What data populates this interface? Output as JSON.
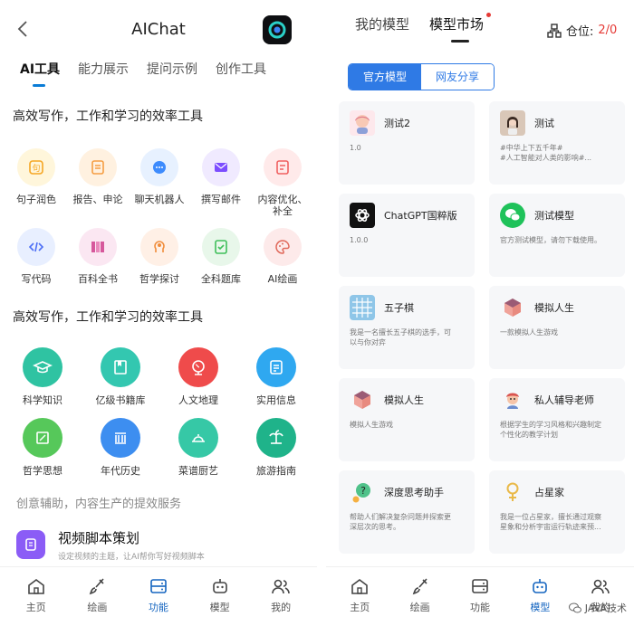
{
  "left": {
    "title": "AIChat",
    "tabs": [
      {
        "label": "AI工具",
        "active": true
      },
      {
        "label": "能力展示",
        "active": false
      },
      {
        "label": "提问示例",
        "active": false
      },
      {
        "label": "创作工具",
        "active": false
      }
    ],
    "section1_title": "高效写作，工作和学习的效率工具",
    "tools": [
      {
        "label": "句子润色",
        "icon": "quote-icon",
        "bg": "#fff6db",
        "fg": "#f5a623"
      },
      {
        "label": "报告、申论",
        "icon": "document-icon",
        "bg": "#fff1e0",
        "fg": "#f59e42"
      },
      {
        "label": "聊天机器人",
        "icon": "chat-bubble-icon",
        "bg": "#e7f1ff",
        "fg": "#3d8bfd"
      },
      {
        "label": "撰写邮件",
        "icon": "mail-icon",
        "bg": "#f0eaff",
        "fg": "#7c4dff"
      },
      {
        "label": "内容优化、补全",
        "icon": "edit-doc-icon",
        "bg": "#ffeaea",
        "fg": "#f06060"
      },
      {
        "label": "写代码",
        "icon": "code-icon",
        "bg": "#e8efff",
        "fg": "#4c6ef5"
      },
      {
        "label": "百科全书",
        "icon": "books-icon",
        "bg": "#fbe7f2",
        "fg": "#d6589c"
      },
      {
        "label": "哲学探讨",
        "icon": "head-icon",
        "bg": "#fff0e6",
        "fg": "#f08c3a"
      },
      {
        "label": "全科题库",
        "icon": "checklist-icon",
        "bg": "#e8f7ea",
        "fg": "#3fbf5a"
      },
      {
        "label": "AI绘画",
        "icon": "palette-icon",
        "bg": "#fdeaea",
        "fg": "#e0685a"
      }
    ],
    "section2_title": "高效写作，工作和学习的效率工具",
    "categories": [
      {
        "label": "科学知识",
        "icon": "graduation-cap-icon",
        "bg": "#2fc3a2"
      },
      {
        "label": "亿级书籍库",
        "icon": "book-icon",
        "bg": "#33c7b0"
      },
      {
        "label": "人文地理",
        "icon": "globe-icon",
        "bg": "#ef4b4b"
      },
      {
        "label": "实用信息",
        "icon": "note-icon",
        "bg": "#2fa8f0"
      },
      {
        "label": "哲学思想",
        "icon": "frame-icon",
        "bg": "#56c85a"
      },
      {
        "label": "年代历史",
        "icon": "columns-icon",
        "bg": "#3d8ef0"
      },
      {
        "label": "菜谱厨艺",
        "icon": "dish-icon",
        "bg": "#36c8a6"
      },
      {
        "label": "旅游指南",
        "icon": "palm-tree-icon",
        "bg": "#1fb38a"
      }
    ],
    "section3_title": "创意辅助，内容生产的提效服务",
    "video": {
      "title": "视频脚本策划",
      "desc": "设定视频的主题，让AI帮你写好视频脚本"
    },
    "nav": [
      {
        "label": "主页",
        "icon": "home-icon",
        "active": false
      },
      {
        "label": "绘画",
        "icon": "brush-icon",
        "active": false
      },
      {
        "label": "功能",
        "icon": "function-icon",
        "active": true
      },
      {
        "label": "模型",
        "icon": "robot-icon",
        "active": false
      },
      {
        "label": "我的",
        "icon": "people-icon",
        "active": false
      }
    ]
  },
  "right": {
    "tabs": [
      {
        "label": "我的模型",
        "active": false
      },
      {
        "label": "模型市场",
        "active": true
      }
    ],
    "slot_label": "仓位:",
    "slot_value": "2/0",
    "segments": [
      {
        "label": "官方模型",
        "active": true
      },
      {
        "label": "网友分享",
        "active": false
      }
    ],
    "cards": [
      {
        "name": "测试2",
        "desc": "1.0",
        "avatar": "anime-girl-avatar"
      },
      {
        "name": "测试",
        "desc": "#中华上下五千年#\n#人工智能对人类的影响#...",
        "avatar": "photo-girl-avatar"
      },
      {
        "name": "ChatGPT国粹版",
        "desc": "1.0.0",
        "avatar": "openai-logo-avatar"
      },
      {
        "name": "测试模型",
        "desc": "官方测试模型，请勿下载使用。",
        "avatar": "wechat-logo-avatar"
      },
      {
        "name": "五子棋",
        "desc": "我是一名擅长五子棋的选手，可\n以与你对弈",
        "avatar": "grid-board-avatar"
      },
      {
        "name": "模拟人生",
        "desc": "一款模拟人生游戏",
        "avatar": "cube-avatar"
      },
      {
        "name": "模拟人生",
        "desc": "模拟人生游戏",
        "avatar": "cube-avatar"
      },
      {
        "name": "私人辅导老师",
        "desc": "根据学生的学习风格和兴趣制定\n个性化的教学计划",
        "avatar": "teacher-avatar"
      },
      {
        "name": "深度思考助手",
        "desc": "帮助人们解决复杂问题并探索更\n深层次的思考。",
        "avatar": "question-avatar"
      },
      {
        "name": "占星家",
        "desc": "我是一位占星家，擅长通过观察\n星象和分析宇宙运行轨迹来预...",
        "avatar": "venus-avatar"
      }
    ],
    "nav": [
      {
        "label": "主页",
        "icon": "home-icon",
        "active": false
      },
      {
        "label": "绘画",
        "icon": "brush-icon",
        "active": false
      },
      {
        "label": "功能",
        "icon": "function-icon",
        "active": false
      },
      {
        "label": "模型",
        "icon": "robot-icon",
        "active": true
      },
      {
        "label": "我的",
        "icon": "people-icon",
        "active": false
      }
    ],
    "watermark": "JAVA技术"
  }
}
